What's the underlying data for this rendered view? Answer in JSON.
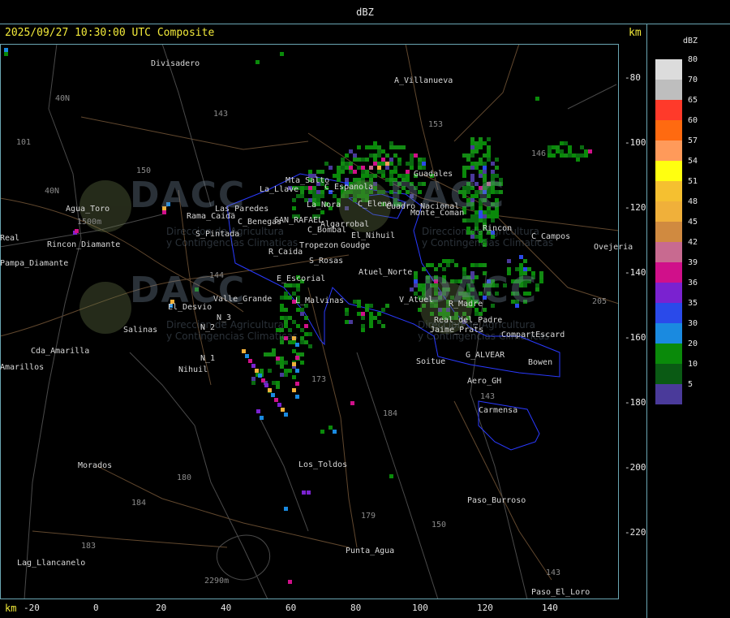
{
  "window": {
    "title": "dBZ"
  },
  "header": {
    "timestamp": "2025/09/27 10:30:00 UTC Composite",
    "unit": "km"
  },
  "legend": {
    "title": "dBZ",
    "levels": [
      {
        "value": "80",
        "color": "#dcdcdc"
      },
      {
        "value": "70",
        "color": "#bebebe"
      },
      {
        "value": "65",
        "color": "#ff3a2a"
      },
      {
        "value": "60",
        "color": "#ff6a10"
      },
      {
        "value": "57",
        "color": "#ff9a5a"
      },
      {
        "value": "54",
        "color": "#ffff10"
      },
      {
        "value": "51",
        "color": "#f5c030"
      },
      {
        "value": "48",
        "color": "#f0b03a"
      },
      {
        "value": "45",
        "color": "#d08a40"
      },
      {
        "value": "42",
        "color": "#c86a90"
      },
      {
        "value": "39",
        "color": "#d0108a"
      },
      {
        "value": "36",
        "color": "#7a22d0"
      },
      {
        "value": "35",
        "color": "#2a4aea"
      },
      {
        "value": "30",
        "color": "#1a8ae0"
      },
      {
        "value": "20",
        "color": "#0a8a0a"
      },
      {
        "value": "10",
        "color": "#0a5a14"
      },
      {
        "value": "5",
        "color": "#4a3a9a"
      }
    ]
  },
  "axes": {
    "y_labels": [
      "-80",
      "-100",
      "-120",
      "-140",
      "-160",
      "-180",
      "-200",
      "-220"
    ],
    "x_unit": "km",
    "x_labels": [
      "-20",
      "0",
      "20",
      "40",
      "60",
      "80",
      "100",
      "120",
      "140"
    ]
  },
  "places": [
    "Divisadero",
    "A_Villanueva",
    "Guadales",
    "Agua_Toro",
    "Pampa_Diamante",
    "Rincon_Diamante",
    "Salinas",
    "Cda_Amarilla",
    "Amarillos",
    "El_Desvio",
    "Valle_Grande",
    "N_3",
    "N_2",
    "N_1",
    "Nihuil",
    "Los_Toldos",
    "Morados",
    "Paso_Burroso",
    "Punta_Agua",
    "Lag_Llancanelo",
    "Paso_El_Loro",
    "Soitue",
    "Aero_GH",
    "Carmensa",
    "Bowen",
    "G_ALVEAR",
    "CompartEscard",
    "V_Atuel",
    "R_Madre",
    "Real_del_Padre",
    "Jaime_Prats",
    "Atuel_Norte",
    "L_Malvinas",
    "E_Escorial",
    "R_Caida",
    "S_Rosas",
    "Tropezon",
    "Goudge",
    "C_Bombal",
    "Algarrobal",
    "SAN_RAFAEL",
    "C_Benegas",
    "S_Pintada",
    "Rama_Caida",
    "Las_Paredes",
    "La_Llave",
    "Mta_Salto",
    "La_Nora",
    "C_Espanola",
    "C_Elena",
    "Cuadro_Nacional",
    "Monte_Coman",
    "El_Nihuil",
    "Ovejeria",
    "C_Campos",
    "Rincon",
    "Real"
  ],
  "route_numbers": [
    "143",
    "153",
    "146",
    "150",
    "101",
    "40N",
    "40N",
    "144",
    "173",
    "184",
    "180",
    "184",
    "183",
    "179",
    "150",
    "143",
    "143",
    "205",
    "2290m",
    "1500m"
  ],
  "watermark": {
    "brand": "DACC",
    "line1": "Direccion de Agricultura",
    "line2": "y Contingencias Climaticas"
  }
}
